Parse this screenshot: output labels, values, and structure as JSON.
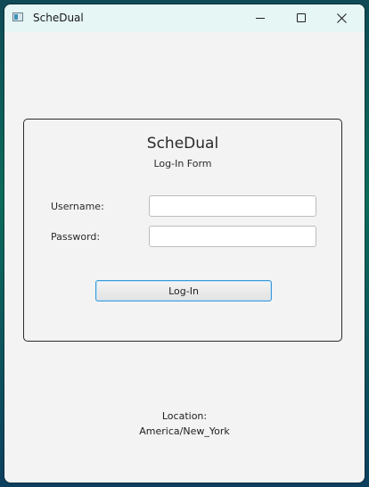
{
  "window": {
    "title": "ScheDual"
  },
  "form": {
    "title": "ScheDual",
    "subtitle": "Log-In Form",
    "username_label": "Username:",
    "password_label": "Password:",
    "username_value": "",
    "password_value": "",
    "login_button": "Log-In"
  },
  "footer": {
    "location_label": "Location:",
    "location_value": "America/New_York"
  },
  "colors": {
    "window_bg": "#f4f3f4",
    "titlebar_bg": "#e5f6f4",
    "button_focus": "#3a9ad9"
  },
  "icons": {
    "app": "app-window-icon",
    "minimize": "minimize-icon",
    "maximize": "maximize-icon",
    "close": "close-icon"
  }
}
